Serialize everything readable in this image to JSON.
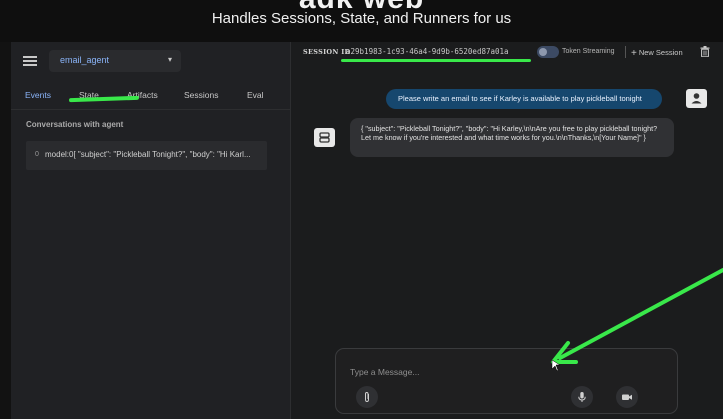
{
  "banner": {
    "title_clip": "adk web",
    "subtitle": "Handles Sessions, State, and Runners for us"
  },
  "sidebar": {
    "agent_select": "email_agent",
    "tabs": [
      "Events",
      "State",
      "Artifacts",
      "Sessions",
      "Eval"
    ],
    "active_tab": "Events",
    "section_label": "Conversations with agent",
    "events": [
      {
        "index": "0",
        "text": "model:0[ \"subject\": \"Pickleball Tonight?\", \"body\": \"Hi Karl..."
      }
    ]
  },
  "header": {
    "session_label": "SESSION ID",
    "session_id": "a29b1983-1c93-46a4-9d9b-6520ed87a01a",
    "token_streaming_label": "Token Streaming",
    "new_session_label": "New Session"
  },
  "chat": {
    "user_message": "Please write an email to see if Karley is available to play pickleball tonight",
    "agent_message": "{ \"subject\": \"Pickleball Tonight?\", \"body\": \"Hi Karley,\\n\\nAre you free to play pickleball tonight? Let me know if you're interested and what time works for you.\\n\\nThanks,\\n[Your Name]\" }"
  },
  "input": {
    "placeholder": "Type a Message..."
  },
  "colors": {
    "accent": "#8ab4f8",
    "user_bubble": "#16476e",
    "annotation_green": "#39e84a"
  }
}
